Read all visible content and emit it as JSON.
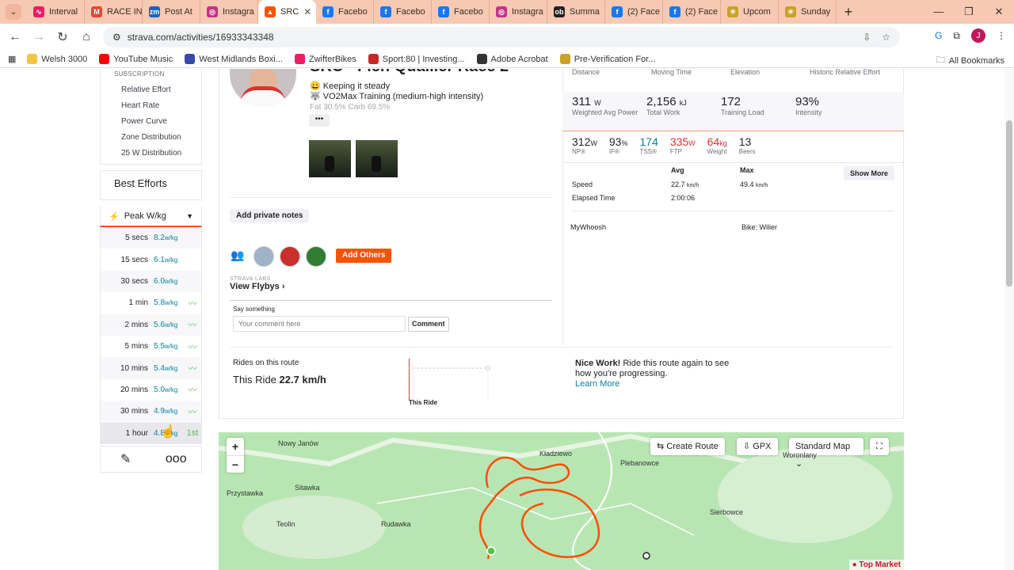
{
  "browser": {
    "tabs": [
      {
        "title": "Interval",
        "color": "#e91e63",
        "glyph": "∿"
      },
      {
        "title": "RACE IN",
        "color": "#ea4335",
        "glyph": "M"
      },
      {
        "title": "Post At",
        "color": "#1565c0",
        "glyph": "zm"
      },
      {
        "title": "Instagra",
        "color": "#c13584",
        "glyph": "◎"
      },
      {
        "title": "SRC",
        "color": "#fc5200",
        "glyph": "▲",
        "active": true
      },
      {
        "title": "Facebo",
        "color": "#1877f2",
        "glyph": "f"
      },
      {
        "title": "Facebo",
        "color": "#1877f2",
        "glyph": "f"
      },
      {
        "title": "Facebo",
        "color": "#1877f2",
        "glyph": "f"
      },
      {
        "title": "Instagra",
        "color": "#c13584",
        "glyph": "◎"
      },
      {
        "title": "Summa",
        "color": "#222222",
        "glyph": "ob"
      },
      {
        "title": "(2) Face",
        "color": "#1877f2",
        "glyph": "f"
      },
      {
        "title": "(2) Face",
        "color": "#1877f2",
        "glyph": "f"
      },
      {
        "title": "Upcom",
        "color": "#c9a227",
        "glyph": "☀"
      },
      {
        "title": "Sunday",
        "color": "#c9a227",
        "glyph": "☀"
      }
    ],
    "url": "strava.com/activities/16933343348",
    "avatar_letter": "J",
    "bookmarks": [
      {
        "label": "Welsh 3000",
        "color": "#f4c542"
      },
      {
        "label": "YouTube Music",
        "color": "#ff0000"
      },
      {
        "label": "West Midlands Boxi...",
        "color": "#3949ab"
      },
      {
        "label": "ZwifterBikes",
        "color": "#e91e63"
      },
      {
        "label": "Sport:80 | Investing...",
        "color": "#c62828"
      },
      {
        "label": "Adobe Acrobat",
        "color": "#333333"
      },
      {
        "label": "Pre-Verification For...",
        "color": "#c9a227"
      }
    ],
    "all_bookmarks": "All Bookmarks"
  },
  "sidebar": {
    "subscription_label": "SUBSCRIPTION",
    "links": [
      "Relative Effort",
      "Heart Rate",
      "Power Curve",
      "Zone Distribution",
      "25 W Distribution"
    ],
    "best_efforts": "Best Efforts",
    "peak_label": "Peak W/kg",
    "efforts": [
      {
        "d": "5 secs",
        "v": "8.2",
        "u": "w/kg",
        "icon": ""
      },
      {
        "d": "15 secs",
        "v": "6.1",
        "u": "w/kg",
        "icon": ""
      },
      {
        "d": "30 secs",
        "v": "6.0",
        "u": "w/kg",
        "icon": ""
      },
      {
        "d": "1 min",
        "v": "5.8",
        "u": "w/kg",
        "icon": "〰"
      },
      {
        "d": "2 mins",
        "v": "5.6",
        "u": "w/kg",
        "icon": "〰"
      },
      {
        "d": "5 mins",
        "v": "5.5",
        "u": "w/kg",
        "icon": "〰"
      },
      {
        "d": "10 mins",
        "v": "5.4",
        "u": "w/kg",
        "icon": "〰"
      },
      {
        "d": "20 mins",
        "v": "5.0",
        "u": "w/kg",
        "icon": "〰"
      },
      {
        "d": "30 mins",
        "v": "4.9",
        "u": "w/kg",
        "icon": "〰"
      },
      {
        "d": "1 hour",
        "v": "4.8",
        "u": "w/kg",
        "icon": "1st"
      }
    ]
  },
  "activity": {
    "title": "SRC - Flen Quallier Race 2",
    "desc": [
      "Keeping it steady",
      "VO2Max Training (medium-high intensity)"
    ],
    "desc_faded": "Fat 30.5%   Carb 69.5%",
    "add_private_notes": "Add private notes",
    "add_others": "Add Others",
    "labs": "STRAVA LABS",
    "view_flybys": "View Flybys",
    "say_something": "Say something",
    "comment_placeholder": "Your comment here",
    "comment_button": "Comment"
  },
  "stats": {
    "header": [
      "Distance",
      "Moving Time",
      "Elevation",
      "Historic Relative Effort"
    ],
    "row1": [
      {
        "v": "311",
        "u": "W",
        "l": "Weighted Avg Power"
      },
      {
        "v": "2,156",
        "u": "kJ",
        "l": "Total Work"
      },
      {
        "v": "172",
        "u": "",
        "l": "Training Load"
      },
      {
        "v": "93%",
        "u": "",
        "l": "Intensity"
      }
    ],
    "row2": [
      {
        "v": "312",
        "u": "W",
        "l": "NP®",
        "color": "#242428"
      },
      {
        "v": "93",
        "u": "%",
        "l": "IF®",
        "color": "#242428"
      },
      {
        "v": "174",
        "u": "",
        "l": "TSS®",
        "color": "#0a7f9e"
      },
      {
        "v": "335",
        "u": "W",
        "l": "FTP",
        "color": "#e03131"
      },
      {
        "v": "64",
        "u": "kg",
        "l": "Weight",
        "color": "#e03131"
      },
      {
        "v": "13",
        "u": "",
        "l": "Beers",
        "color": "#242428"
      }
    ],
    "avg_label": "Avg",
    "max_label": "Max",
    "show_more": "Show More",
    "speed_label": "Speed",
    "speed_avg": "22.7",
    "speed_max": "49.4",
    "speed_unit": "km/h",
    "elapsed_label": "Elapsed Time",
    "elapsed": "2:00:06",
    "device": "MyWhoosh",
    "bike": "Bike: Wilier"
  },
  "rides": {
    "title": "Rides on this route",
    "this_ride_label": "This Ride",
    "this_ride_value": "22.7 km/h",
    "chart_label": "This Ride",
    "nice_bold": "Nice Work!",
    "nice_text": "Ride this route again to see how you're progressing.",
    "learn_more": "Learn More"
  },
  "map": {
    "create_route": "Create Route",
    "gpx": "GPX",
    "map_type": "Standard Map",
    "towns": [
      {
        "name": "Nowy Janów"
      },
      {
        "name": "Kładziewo"
      },
      {
        "name": "Plebanowce"
      },
      {
        "name": "Woronlany"
      },
      {
        "name": "Sitawka"
      },
      {
        "name": "Przystawka"
      },
      {
        "name": "Sierbowce"
      },
      {
        "name": "Teolin"
      },
      {
        "name": "Rudawka"
      }
    ],
    "top_markets": "Top Market"
  }
}
